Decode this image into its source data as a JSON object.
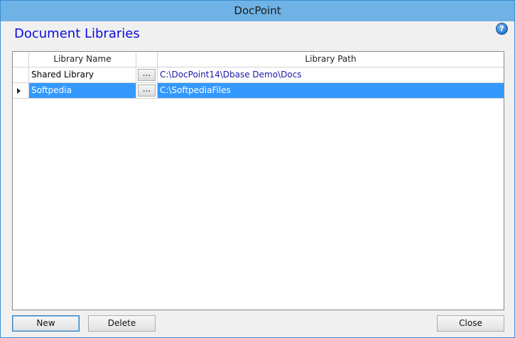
{
  "window": {
    "title": "DocPoint"
  },
  "header": {
    "heading": "Document Libraries",
    "help_icon": "help-icon",
    "help_glyph": "?"
  },
  "grid": {
    "columns": [
      "",
      "Library Name",
      "",
      "Library Path"
    ],
    "rows": [
      {
        "name": "Shared Library",
        "browse": "...",
        "path": "C:\\DocPoint14\\Dbase Demo\\Docs",
        "selected": false
      },
      {
        "name": "Softpedia",
        "browse": "...",
        "path": "C:\\SoftpediaFiles",
        "selected": true
      }
    ]
  },
  "buttons": {
    "new": "New",
    "delete": "Delete",
    "close": "Close"
  },
  "colors": {
    "title_bar": "#6fb2e6",
    "heading": "#0b0bdd",
    "selection": "#3399ff",
    "path_text": "#1a1aa8"
  }
}
